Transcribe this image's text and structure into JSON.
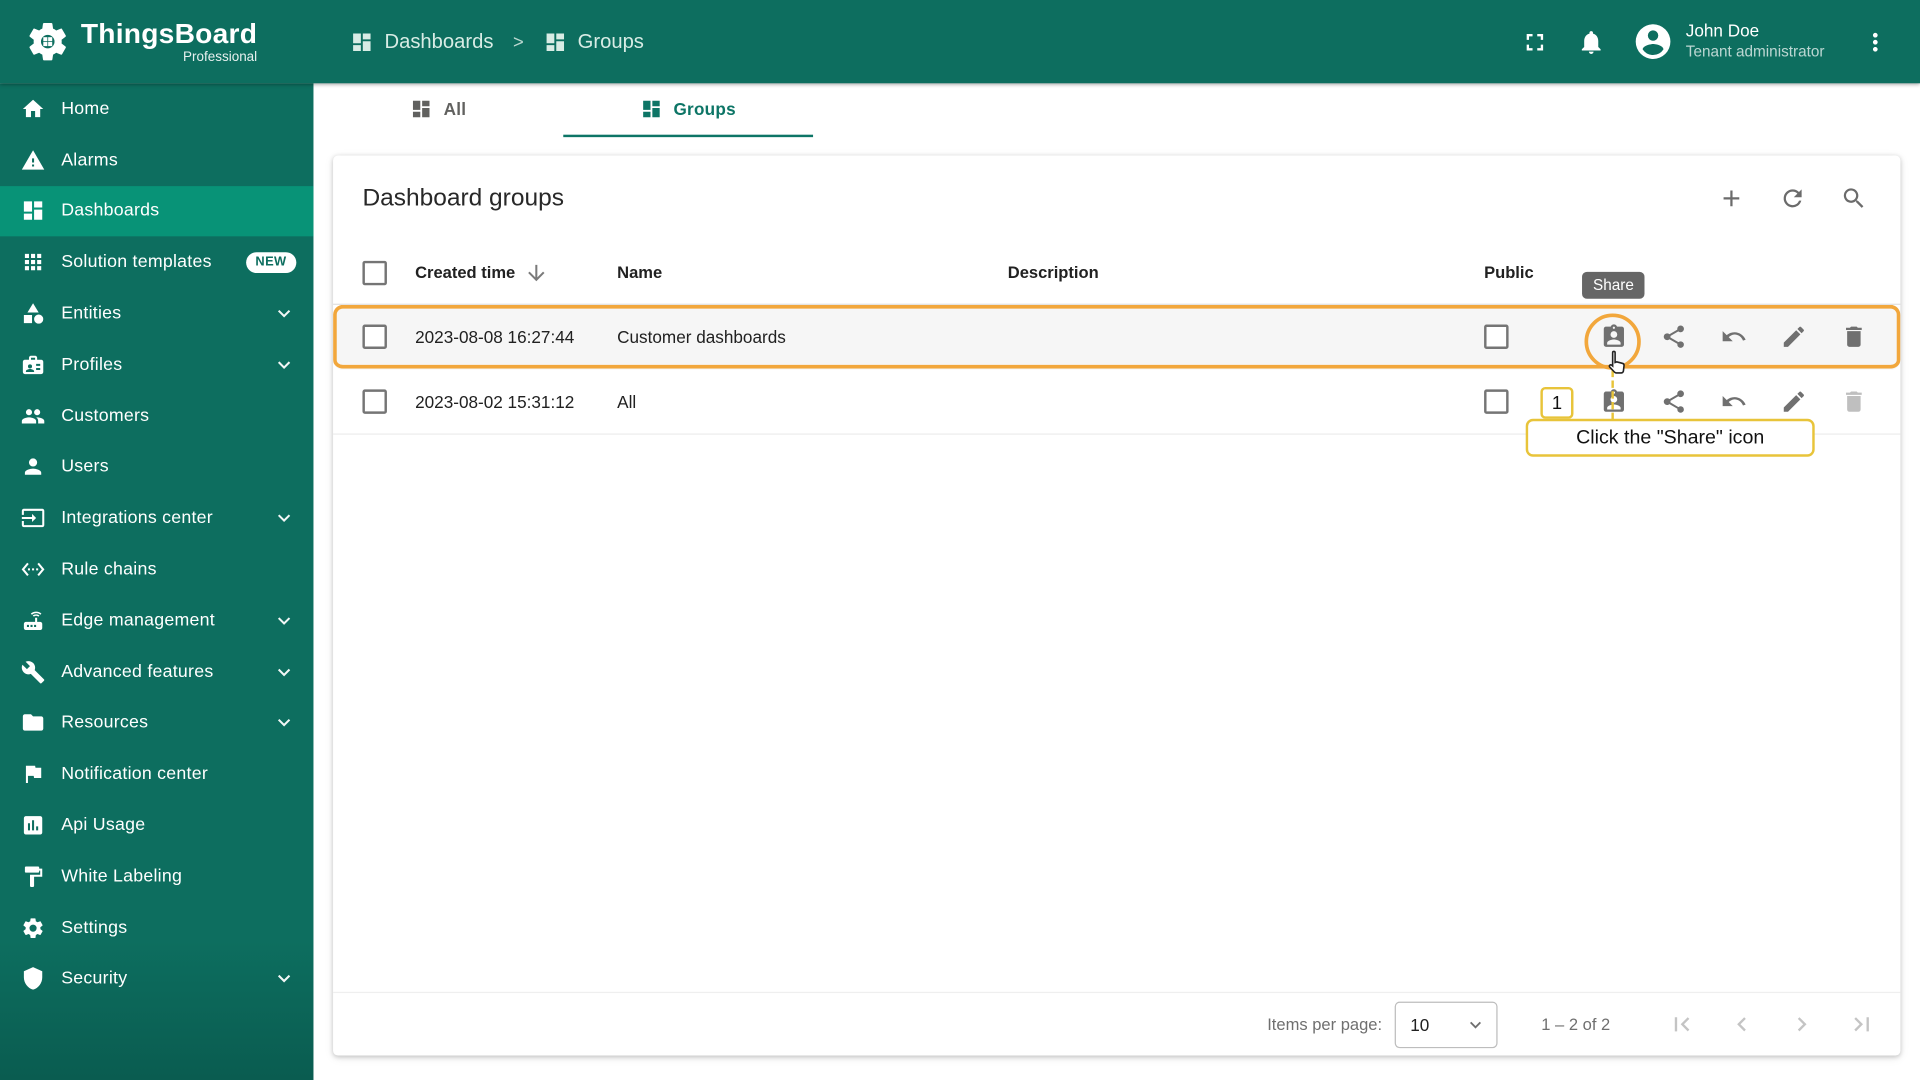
{
  "logo": {
    "title": "ThingsBoard",
    "subtitle": "Professional"
  },
  "header": {
    "breadcrumb": [
      {
        "label": "Dashboards",
        "icon": "dashboards-icon"
      },
      {
        "label": "Groups",
        "icon": "groups-icon"
      }
    ],
    "separator": ">",
    "user": {
      "name": "John Doe",
      "role": "Tenant administrator"
    },
    "icons": [
      "fullscreen-icon",
      "notifications-bell-icon",
      "avatar",
      "more-menu-icon"
    ]
  },
  "sidebar": {
    "items": [
      {
        "label": "Home",
        "icon": "home-icon"
      },
      {
        "label": "Alarms",
        "icon": "alarms-icon"
      },
      {
        "label": "Dashboards",
        "icon": "dashboards-icon",
        "active": true
      },
      {
        "label": "Solution templates",
        "icon": "solution-templates-icon",
        "badge": "NEW"
      },
      {
        "label": "Entities",
        "icon": "entities-icon",
        "expandable": true
      },
      {
        "label": "Profiles",
        "icon": "profiles-icon",
        "expandable": true
      },
      {
        "label": "Customers",
        "icon": "customers-icon"
      },
      {
        "label": "Users",
        "icon": "users-icon"
      },
      {
        "label": "Integrations center",
        "icon": "integrations-icon",
        "expandable": true
      },
      {
        "label": "Rule chains",
        "icon": "rule-chains-icon"
      },
      {
        "label": "Edge management",
        "icon": "edge-management-icon",
        "expandable": true
      },
      {
        "label": "Advanced features",
        "icon": "advanced-features-icon",
        "expandable": true
      },
      {
        "label": "Resources",
        "icon": "resources-icon",
        "expandable": true
      },
      {
        "label": "Notification center",
        "icon": "notification-center-icon"
      },
      {
        "label": "Api Usage",
        "icon": "api-usage-icon"
      },
      {
        "label": "White Labeling",
        "icon": "white-labeling-icon"
      },
      {
        "label": "Settings",
        "icon": "settings-icon"
      },
      {
        "label": "Security",
        "icon": "security-icon",
        "expandable": true
      }
    ]
  },
  "tabs": [
    {
      "label": "All",
      "icon": "all-tab-icon"
    },
    {
      "label": "Groups",
      "icon": "groups-tab-icon",
      "active": true
    }
  ],
  "panel": {
    "title": "Dashboard groups",
    "toolbar_icons": [
      "add-icon",
      "refresh-icon",
      "search-icon"
    ]
  },
  "table": {
    "columns": [
      "Created time",
      "Name",
      "Description",
      "Public"
    ],
    "sorted_by": "Created time",
    "rows": [
      {
        "created_time": "2023-08-08 16:27:44",
        "name": "Customer dashboards",
        "description": "",
        "public_checked": false,
        "highlighted": true
      },
      {
        "created_time": "2023-08-02 15:31:12",
        "name": "All",
        "description": "",
        "public_checked": false
      }
    ],
    "row_actions": [
      "share",
      "make-public",
      "make-private",
      "edit",
      "delete"
    ]
  },
  "overlay": {
    "tooltip": "Share",
    "step": "1",
    "label": "Click the \"Share\" icon"
  },
  "pagination": {
    "items_per_page_label": "Items per page:",
    "page_size": "10",
    "range": "1 – 2 of 2"
  },
  "colors": {
    "primary": "#0d6e5f",
    "active_nav": "#089377",
    "highlight_orange": "#f2a73c",
    "highlight_yellow": "#e8c43a",
    "tooltip_bg": "#666666"
  }
}
